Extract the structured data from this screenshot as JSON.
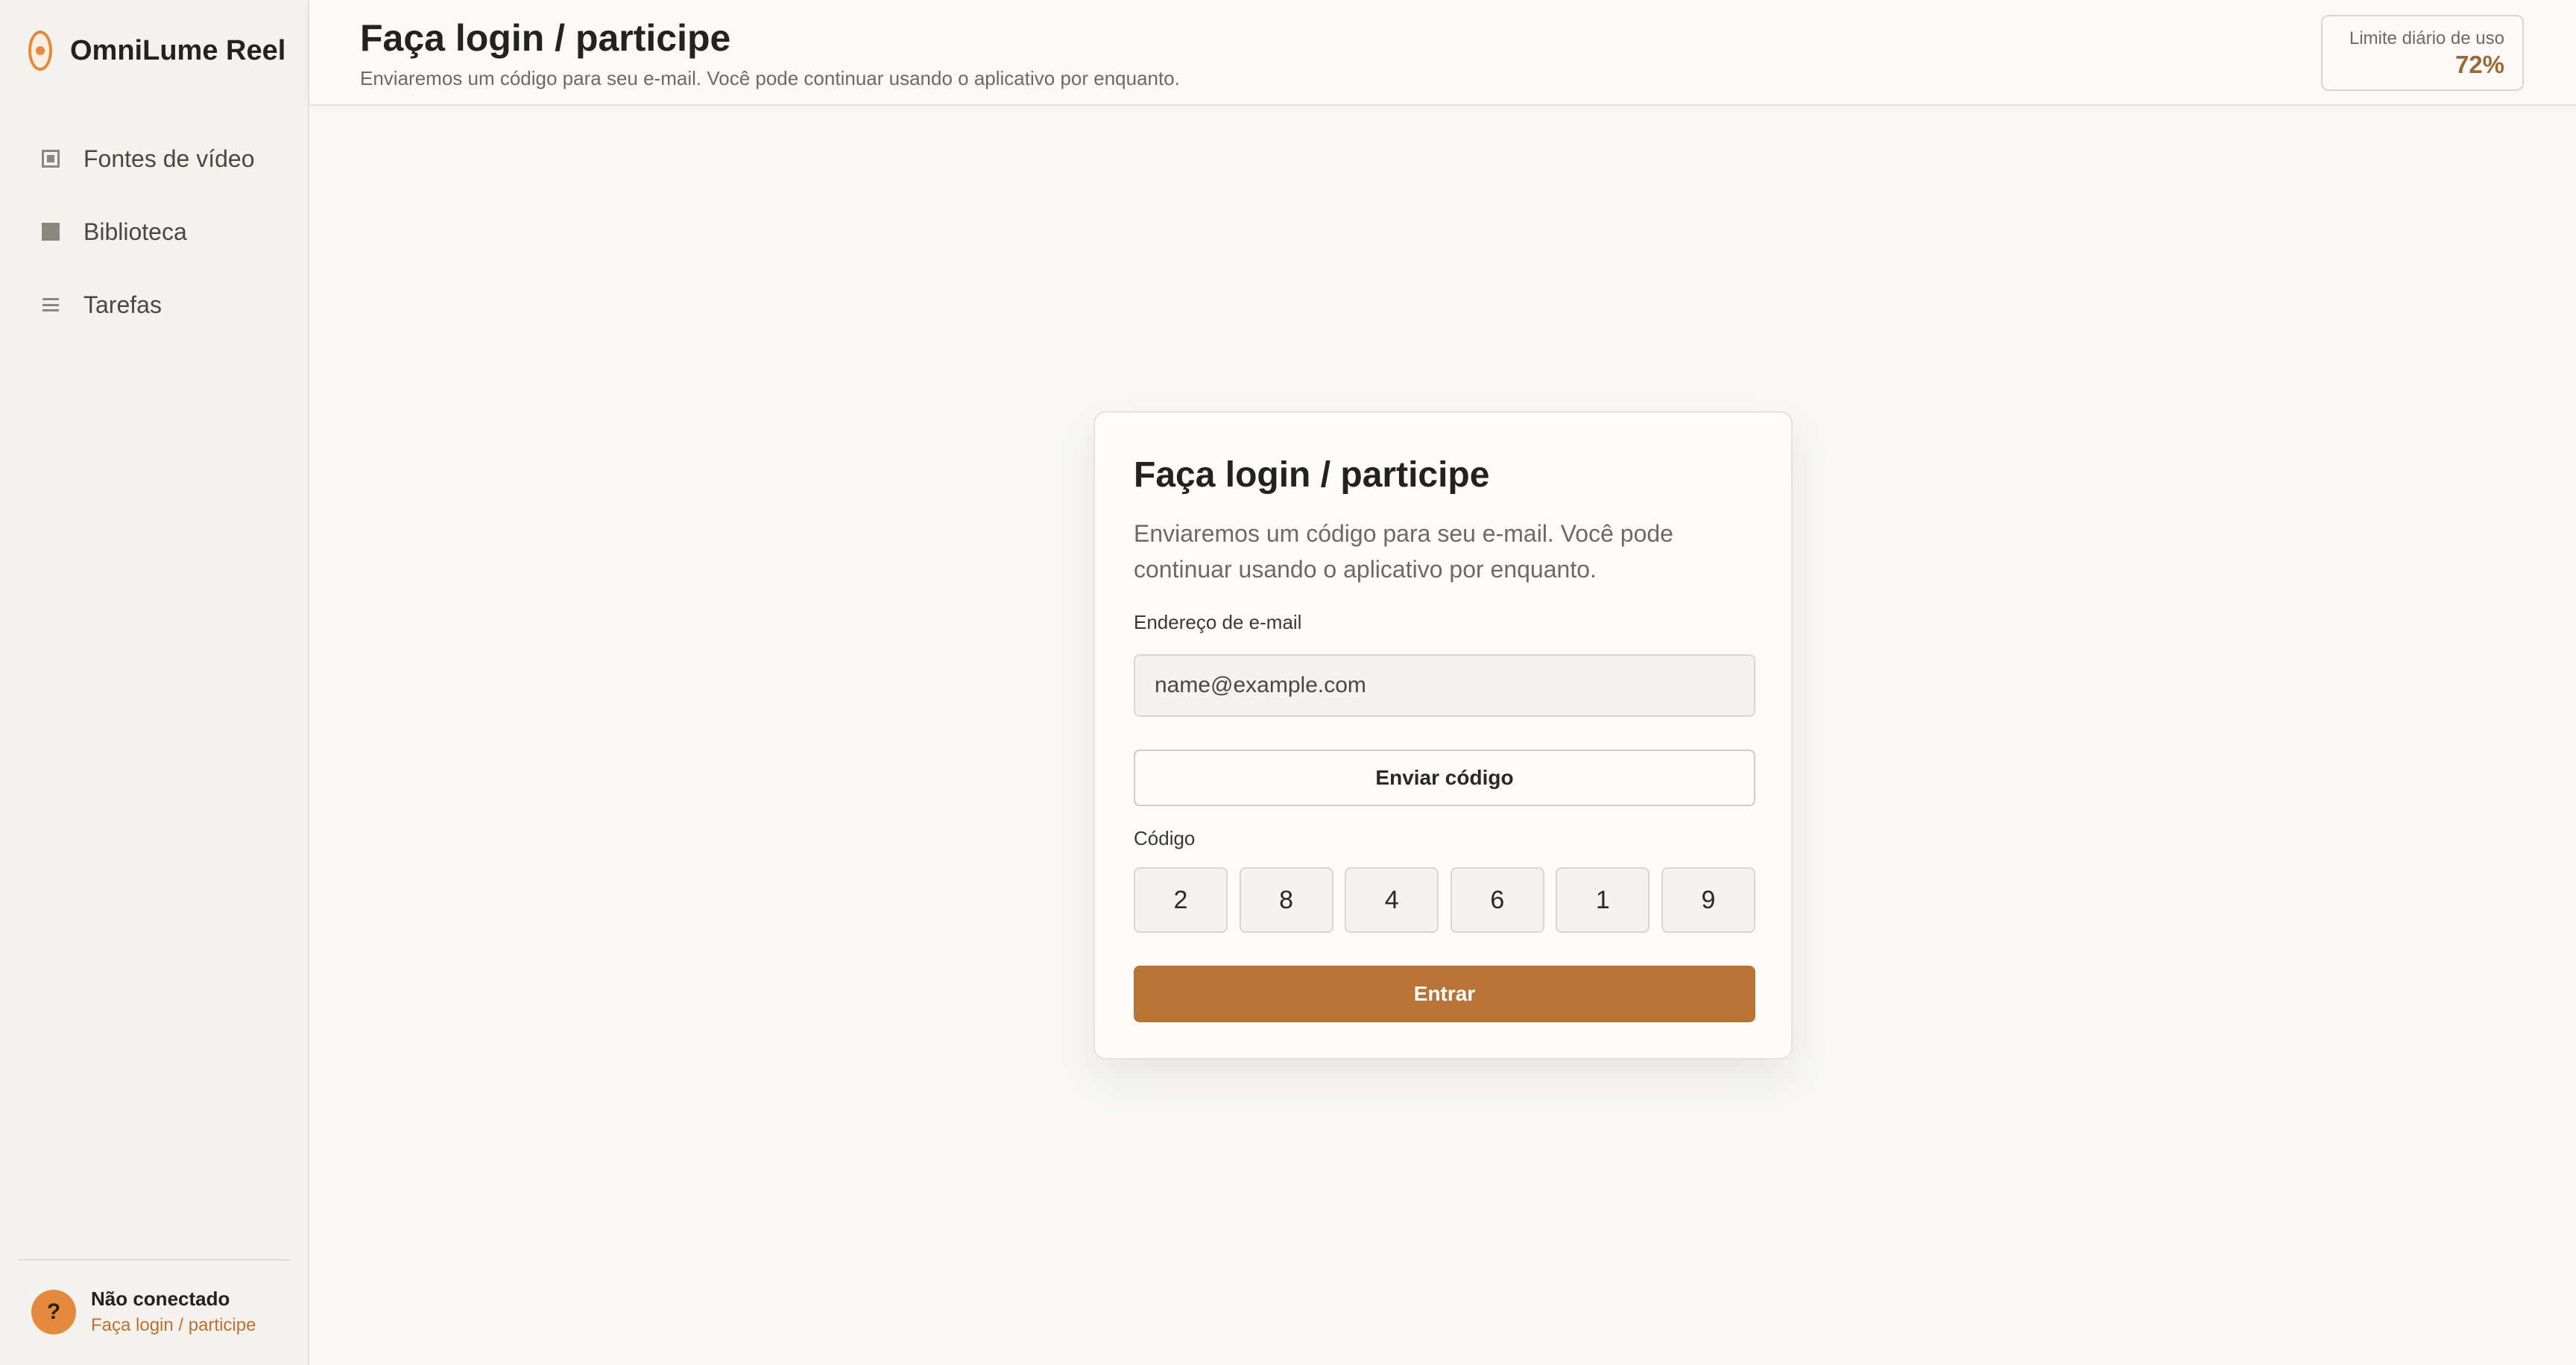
{
  "app": {
    "name": "OmniLume Reel"
  },
  "sidebar": {
    "items": [
      {
        "label": "Fontes de vídeo",
        "icon": "video-source-icon"
      },
      {
        "label": "Biblioteca",
        "icon": "library-icon"
      },
      {
        "label": "Tarefas",
        "icon": "tasks-icon"
      }
    ],
    "footer": {
      "avatar_symbol": "?",
      "status": "Não conectado",
      "link": "Faça login / participe"
    }
  },
  "header": {
    "title": "Faça login / participe",
    "subtitle": "Enviaremos um código para seu e-mail. Você pode continuar usando o aplicativo por enquanto.",
    "usage": {
      "label": "Limite diário de uso",
      "value": "72%"
    }
  },
  "login": {
    "title": "Faça login / participe",
    "description": "Enviaremos um código para seu e-mail. Você pode continuar usando o aplicativo por enquanto.",
    "email_label": "Endereço de e-mail",
    "email_placeholder": "name@example.com",
    "email_value": "",
    "send_button": "Enviar código",
    "code_label": "Código",
    "code_digits": [
      "2",
      "8",
      "4",
      "6",
      "1",
      "9"
    ],
    "submit_button": "Entrar"
  },
  "colors": {
    "accent": "#b87436",
    "logo": "#e48a3c",
    "link": "#c0702c",
    "usage_value": "#9a6a36"
  }
}
